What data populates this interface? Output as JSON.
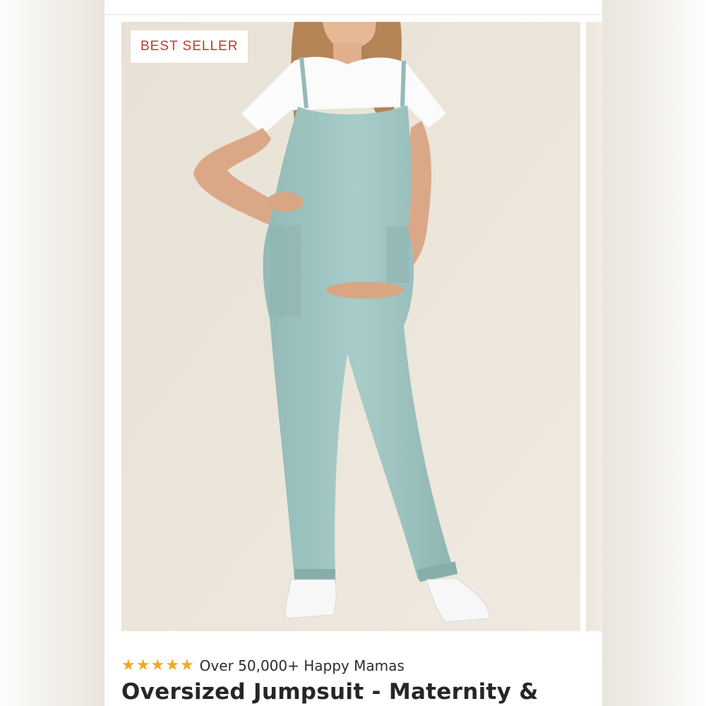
{
  "badge": {
    "label": "BEST SELLER"
  },
  "rating": {
    "stars_filled": 5,
    "stars_total": 5,
    "text": "Over 50,000+ Happy Mamas"
  },
  "product": {
    "title": "Oversized Jumpsuit - Maternity &"
  },
  "colors": {
    "badge_text": "#c43a2c",
    "star": "#f2a81f",
    "jumpsuit": "#9fc4c1"
  },
  "icons": [
    "star-icon"
  ]
}
